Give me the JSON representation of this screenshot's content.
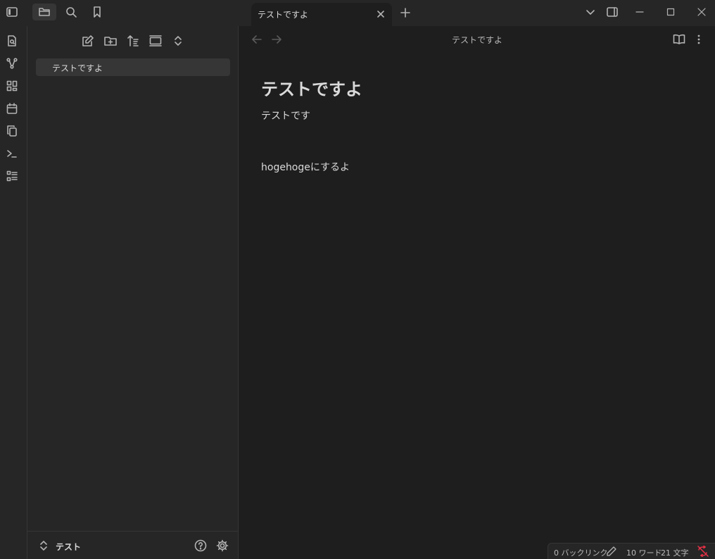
{
  "titlebar": {
    "tab_label": "テストですよ",
    "buttons": [
      "sidebar-toggle-icon",
      "folder-icon",
      "search-icon",
      "bookmark-icon"
    ],
    "window_controls": [
      "chevron-down-icon",
      "right-sidebar-icon",
      "minimize-icon",
      "maximize-icon",
      "close-icon"
    ]
  },
  "ribbon": {
    "icons": [
      "switcher-icon",
      "graph-icon",
      "canvas-icon",
      "calendar-icon",
      "copy-icon",
      "terminal-icon",
      "outline-icon"
    ]
  },
  "sidebar": {
    "nav_icons": [
      "new-note-icon",
      "new-folder-icon",
      "sort-icon",
      "collapse-icon",
      "expand-icon"
    ],
    "files": [
      {
        "label": "テストですよ"
      }
    ],
    "vault_name": "テスト"
  },
  "editor": {
    "view_title": "テストですよ",
    "note_title": "テストですよ",
    "lines": [
      "テストです",
      "hogehogeにするよ"
    ]
  },
  "status": {
    "backlinks": "0 バックリンク",
    "words": "10 ワード",
    "chars": "21 文字"
  },
  "colors": {
    "background": "#1e1e1e",
    "panel": "#262626",
    "border": "#363636",
    "text": "#dadada",
    "sync_error": "#e93147"
  }
}
